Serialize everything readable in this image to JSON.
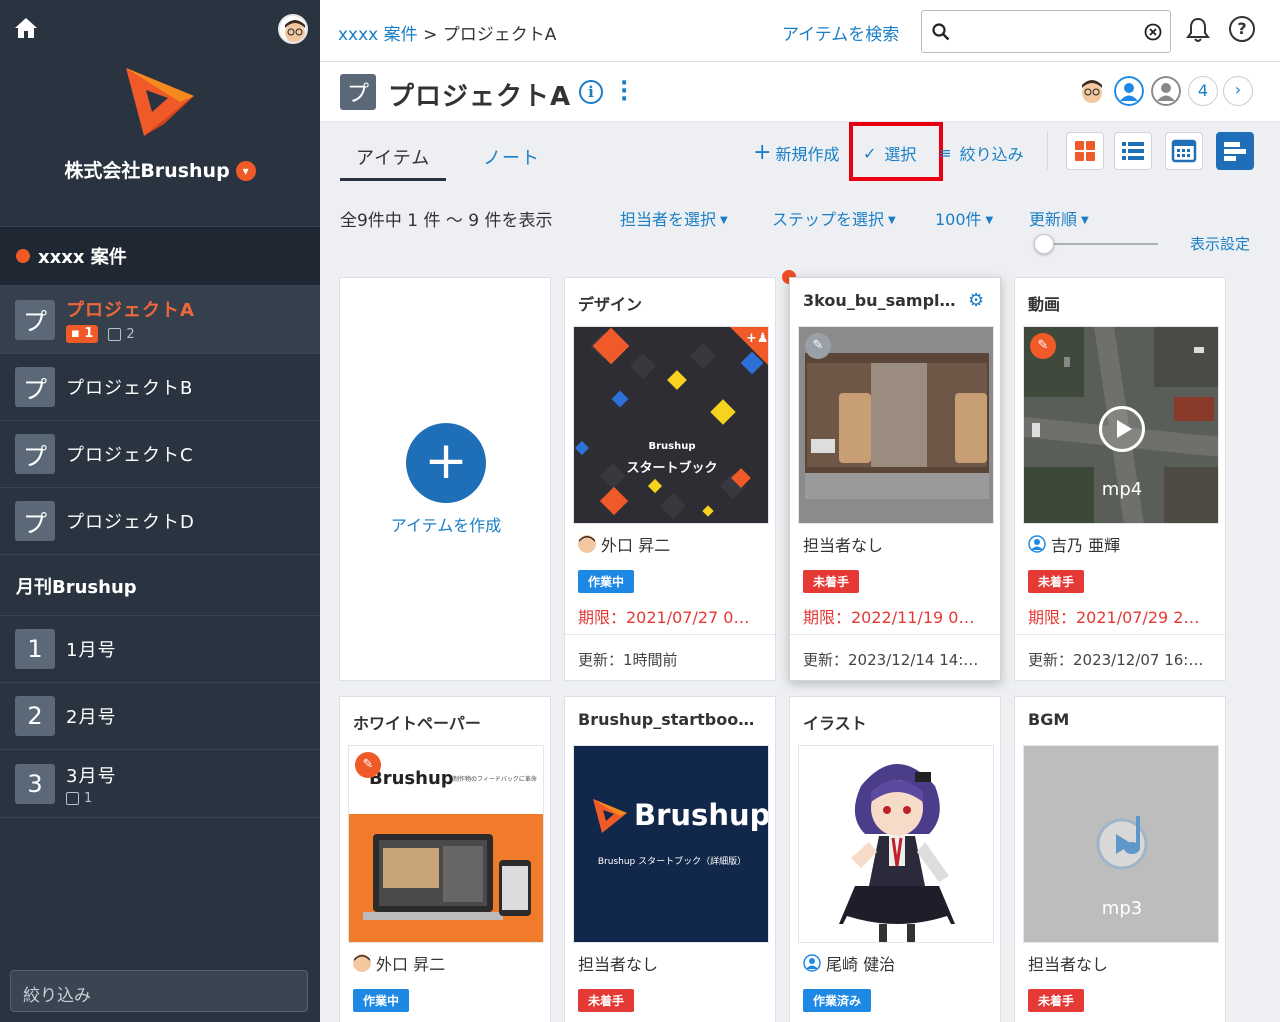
{
  "sidebar": {
    "company": "株式会社Brushup",
    "group1": "xxxx 案件",
    "projects": [
      {
        "badge": "プ",
        "name": "プロジェクトA",
        "comments": "1",
        "checks": "2"
      },
      {
        "badge": "プ",
        "name": "プロジェクトB"
      },
      {
        "badge": "プ",
        "name": "プロジェクトC"
      },
      {
        "badge": "プ",
        "name": "プロジェクトD"
      }
    ],
    "group2": "月刊Brushup",
    "issues": [
      {
        "badge": "1",
        "name": "1月号"
      },
      {
        "badge": "2",
        "name": "2月号"
      },
      {
        "badge": "3",
        "name": "3月号",
        "checks": "1"
      }
    ],
    "filter_placeholder": "絞り込み"
  },
  "topbar": {
    "breadcrumb_link": "xxxx 案件",
    "breadcrumb_sep": ">",
    "breadcrumb_current": "プロジェクトA",
    "search_link": "アイテムを検索",
    "search_value": ""
  },
  "project": {
    "badge": "プ",
    "title": "プロジェクトA",
    "member_count": "4"
  },
  "tabs": {
    "items": "アイテム",
    "notes": "ノート"
  },
  "toolbar": {
    "new": "新規作成",
    "select": "選択",
    "filter": "絞り込み"
  },
  "filterbar": {
    "count": "全9件中 1 件 〜 9 件を表示",
    "assignee": "担当者を選択",
    "step": "ステップを選択",
    "per_page": "100件",
    "sort": "更新順",
    "display_settings": "表示設定"
  },
  "create_card": {
    "label": "アイテムを作成"
  },
  "cards": [
    {
      "title": "デザイン",
      "assignee": "外口 昇二",
      "status": "作業中",
      "deadline": "期限：2021/07/27 0…",
      "updated": "更新：1時間前",
      "thumb_brand": "Brushup",
      "thumb_text": "スタートブック"
    },
    {
      "title": "3kou_bu_sample…",
      "assignee": "担当者なし",
      "status": "未着手",
      "deadline": "期限：2022/11/19 0…",
      "updated": "更新：2023/12/14 14:…"
    },
    {
      "title": "動画",
      "assignee": "吉乃 亜輝",
      "status": "未着手",
      "deadline": "期限：2021/07/29 2…",
      "updated": "更新：2023/12/07 16:…",
      "thumb_label": "mp4"
    },
    {
      "title": "ホワイトペーパー",
      "assignee": "外口 昇二",
      "status": "作業中",
      "thumb_brand": "Brushup",
      "thumb_tag": "制作物のフィードバックに革命"
    },
    {
      "title": "Brushup_startbook…",
      "assignee": "担当者なし",
      "status": "未着手",
      "thumb_brand": "Brushup",
      "thumb_sub": "Brushup スタートブック（詳細版）"
    },
    {
      "title": "イラスト",
      "assignee": "尾崎 健治",
      "status": "作業済み"
    },
    {
      "title": "BGM",
      "assignee": "担当者なし",
      "status": "未着手",
      "thumb_label": "mp3"
    }
  ],
  "colors": {
    "accent": "#1a7fc6",
    "brand": "#ef5a28",
    "sidebar": "#2a3441",
    "highlight": "#e60012"
  }
}
